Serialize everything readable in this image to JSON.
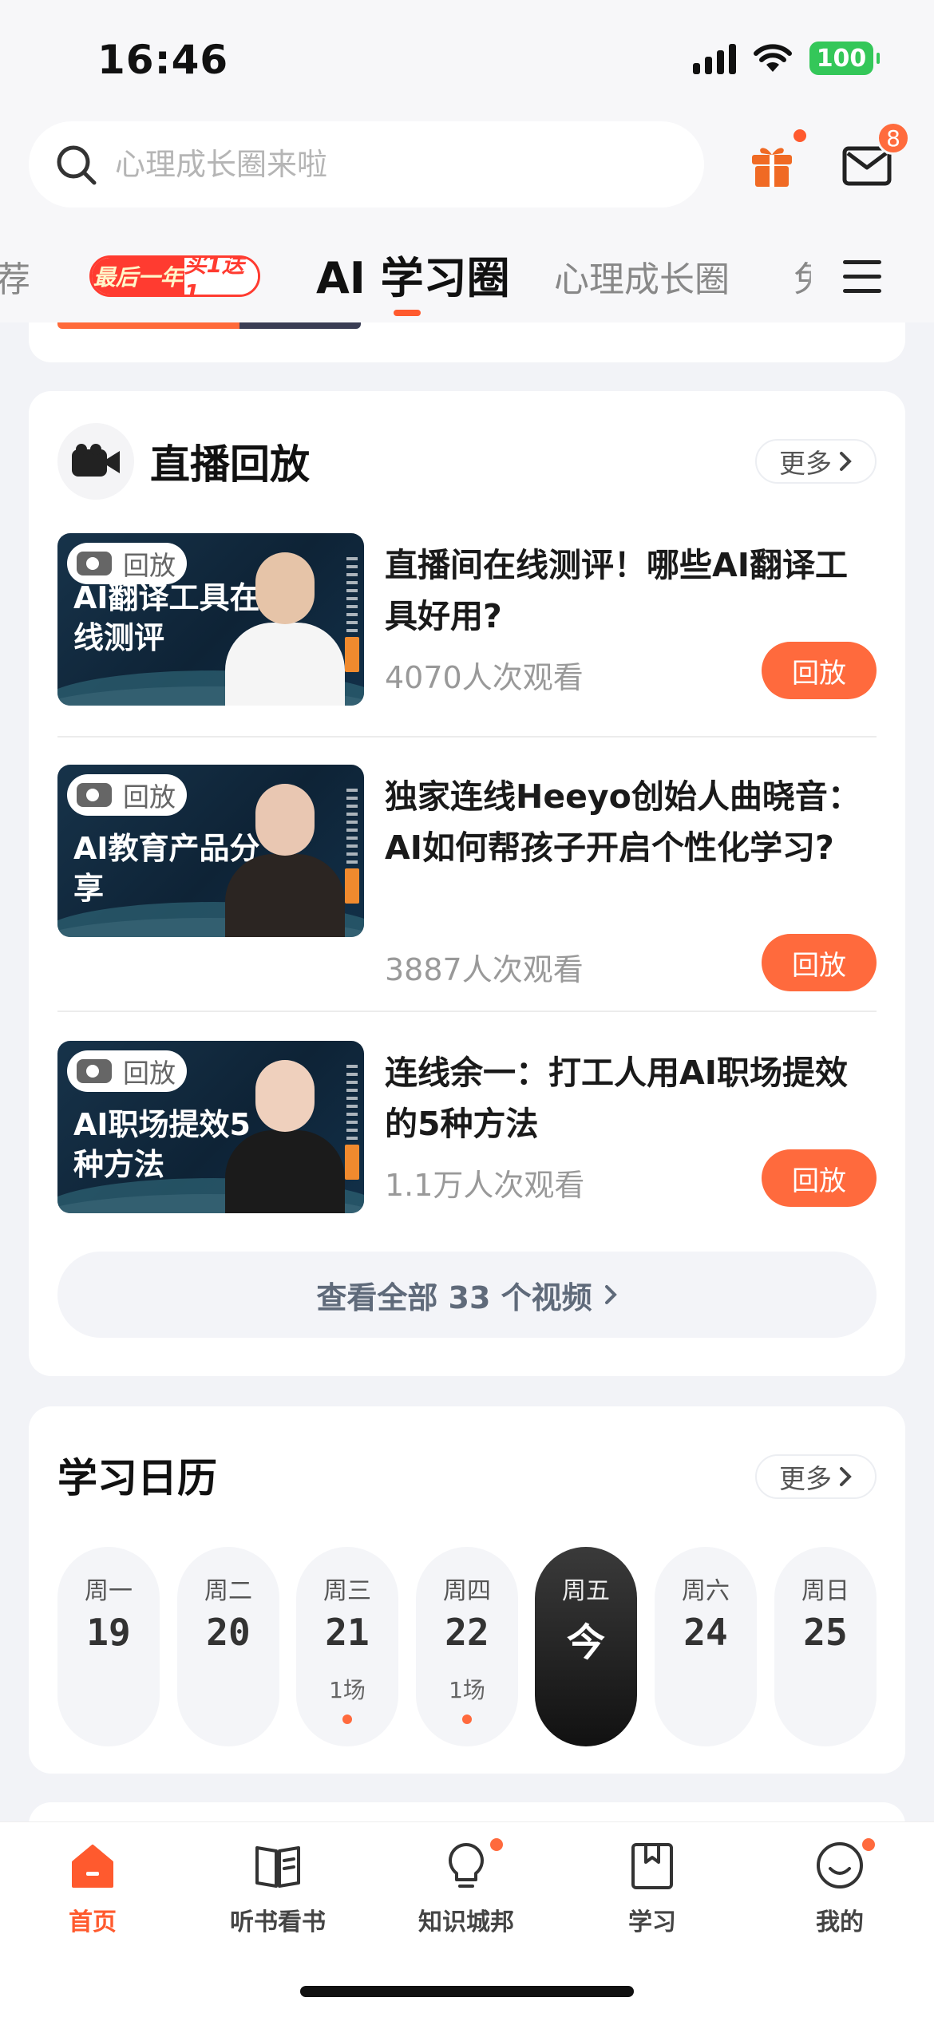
{
  "status_bar": {
    "time": "16:46",
    "battery": "100"
  },
  "header": {
    "search_placeholder": "心理成长圈来啦",
    "mail_badge": "8"
  },
  "tabs": {
    "recommend_partial": "荐",
    "promo_left": "最后一年",
    "promo_right": "买1送1",
    "active": "AI 学习圈",
    "psychology": "心理成长圈",
    "cut_partial": "免"
  },
  "live_replay": {
    "title": "直播回放",
    "more": "更多",
    "replay_tag": "回放",
    "videos": [
      {
        "title": "直播间在线测评！哪些AI翻译工具好用?",
        "thumb_text": "AI翻译工具在线测评",
        "views": "4070人次观看",
        "button": "回放"
      },
      {
        "title": "独家连线Heeyo创始人曲晓音：AI如何帮孩子开启个性化学习?",
        "thumb_text": "AI教育产品分享",
        "views": "3887人次观看",
        "button": "回放"
      },
      {
        "title": "连线余一：打工人用AI职场提效的5种方法",
        "thumb_text": "AI职场提效5种方法",
        "views": "1.1万人次观看",
        "button": "回放"
      }
    ],
    "view_all": "查看全部 33 个视频"
  },
  "calendar": {
    "title": "学习日历",
    "more": "更多",
    "days": [
      {
        "weekday": "周一",
        "date": "19",
        "count": ""
      },
      {
        "weekday": "周二",
        "date": "20",
        "count": ""
      },
      {
        "weekday": "周三",
        "date": "21",
        "count": "1场"
      },
      {
        "weekday": "周四",
        "date": "22",
        "count": "1场"
      },
      {
        "weekday": "周五",
        "date": "今",
        "count": ""
      },
      {
        "weekday": "周六",
        "date": "24",
        "count": ""
      },
      {
        "weekday": "周日",
        "date": "25",
        "count": ""
      }
    ]
  },
  "bottom_nav": {
    "home": "首页",
    "books": "听书看书",
    "knowledge": "知识城邦",
    "study": "学习",
    "mine": "我的"
  },
  "colors": {
    "accent": "#ff6a3d",
    "active_tab": "#111111",
    "battery": "#34c759"
  }
}
